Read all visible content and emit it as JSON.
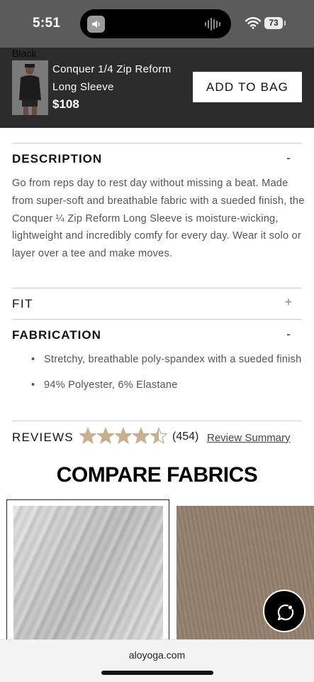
{
  "status_bar": {
    "time": "5:51",
    "battery": "73"
  },
  "product_bar": {
    "color": "Black",
    "name": "Conquer 1/4 Zip Reform Long Sleeve",
    "price": "$108",
    "add_to_bag": "ADD TO BAG"
  },
  "description": {
    "title": "DESCRIPTION",
    "toggle": "-",
    "text": "Go from reps day to rest day without missing a beat. Made from super-soft and breathable fabric with a sueded finish, the Conquer ¼ Zip Reform Long Sleeve is moisture-wicking, lightweight and incredibly comfy for every day. Wear it solo or layer over a tee and make moves."
  },
  "fit": {
    "title": "FIT",
    "toggle": "+"
  },
  "fabrication": {
    "title": "FABRICATION",
    "toggle": "-",
    "items": [
      "Stretchy, breathable poly-spandex with a sueded finish",
      "94% Polyester, 6% Elastane"
    ]
  },
  "reviews": {
    "label": "REVIEWS",
    "rating": 4.5,
    "max_rating": 5,
    "star_color": "#c8b08f",
    "count": "(454)",
    "summary_link": "Review Summary"
  },
  "compare": {
    "title": "COMPARE FABRICS",
    "swatch_colors": [
      "#cfcfcf",
      "#927f6c"
    ]
  },
  "browser": {
    "url": "aloyoga.com"
  }
}
